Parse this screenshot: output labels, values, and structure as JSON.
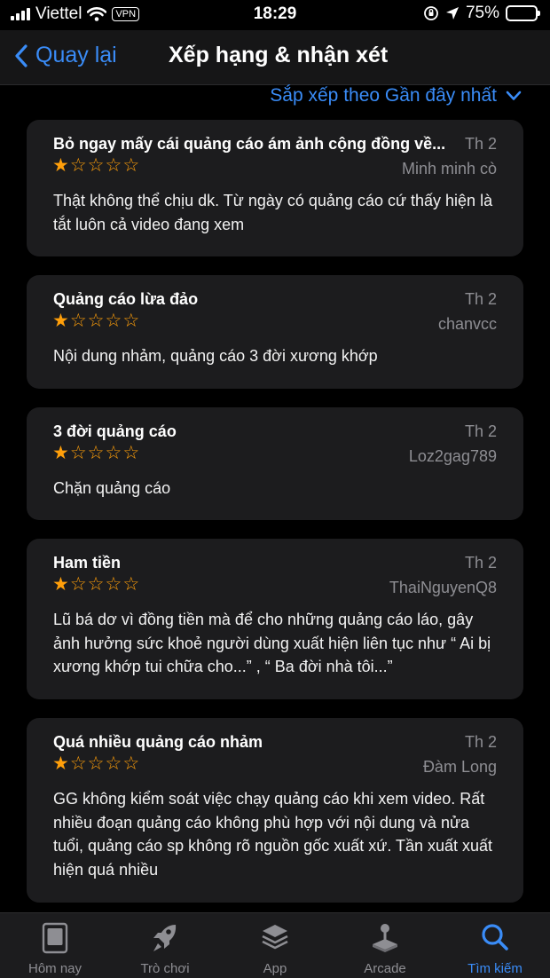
{
  "status_bar": {
    "carrier": "Viettel",
    "vpn": "VPN",
    "time": "18:29",
    "battery": "75%",
    "battery_level": 0.75
  },
  "nav": {
    "back_label": "Quay lại",
    "title": "Xếp hạng & nhận xét"
  },
  "sort": {
    "label": "Sắp xếp theo Gần đây nhất"
  },
  "reviews": [
    {
      "title": "Bỏ ngay mấy cái quảng cáo ám ảnh cộng đồng về...",
      "date": "Th 2",
      "author": "Minh minh cò",
      "rating": 1,
      "body": "Thật không thể chịu dk. Từ ngày có quảng cáo cứ thấy hiện là tắt luôn cả video đang xem"
    },
    {
      "title": "Quảng cáo lừa đảo",
      "date": "Th 2",
      "author": "chanvcc",
      "rating": 1,
      "body": "Nội dung nhảm, quảng cáo 3 đời xương khớp"
    },
    {
      "title": "3 đời quảng cáo",
      "date": "Th 2",
      "author": "Loz2gag789",
      "rating": 1,
      "body": "Chặn quảng cáo"
    },
    {
      "title": "Ham tiền",
      "date": "Th 2",
      "author": "ThaiNguyenQ8",
      "rating": 1,
      "body": "Lũ bá dơ vì đồng tiền mà để cho những quảng cáo láo, gây ảnh hưởng sức khoẻ người dùng xuất hiện liên tục như “ Ai bị xương khớp tui chữa cho...” , “ Ba đời nhà tôi...”"
    },
    {
      "title": "Quá nhiều quảng cáo nhảm",
      "date": "Th 2",
      "author": "Đàm Long",
      "rating": 1,
      "body": "GG không kiểm soát việc chạy quảng cáo khi xem video. Rất nhiều đoạn quảng cáo không phù hợp với nội dung và nửa tuổi, quảng cáo sp không rõ nguồn gốc xuất xứ. Tần xuất xuất hiện quá nhiều"
    }
  ],
  "tabs": [
    {
      "label": "Hôm nay",
      "icon": "today-icon",
      "active": false
    },
    {
      "label": "Trò chơi",
      "icon": "rocket-icon",
      "active": false
    },
    {
      "label": "App",
      "icon": "apps-stack-icon",
      "active": false
    },
    {
      "label": "Arcade",
      "icon": "joystick-icon",
      "active": false
    },
    {
      "label": "Tìm kiếm",
      "icon": "search-icon",
      "active": true
    }
  ],
  "colors": {
    "accent": "#3a8cf7",
    "star": "#ff9f0a",
    "card": "#1c1c1e",
    "muted": "#8e8e93",
    "battery": "#34c759"
  }
}
